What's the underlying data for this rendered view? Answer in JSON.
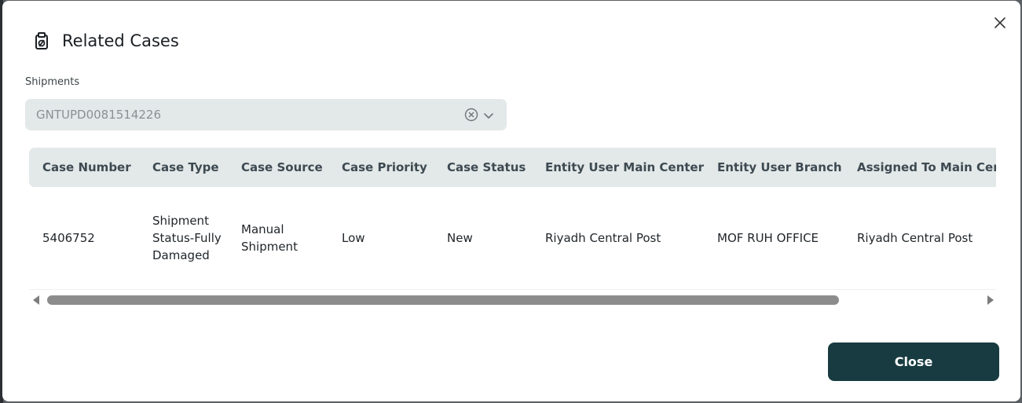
{
  "dialog": {
    "title": "Related Cases",
    "title_icon": "clipboard-edit-icon",
    "close_icon": "close-icon"
  },
  "shipments": {
    "label": "Shipments",
    "value": "GNTUPD0081514226",
    "clear_icon": "clear-circle-icon",
    "chevron_icon": "chevron-down-icon"
  },
  "table": {
    "columns": [
      "Case Number",
      "Case Type",
      "Case Source",
      "Case Priority",
      "Case Status",
      "Entity User Main Center",
      "Entity User Branch",
      "Assigned To Main Center"
    ],
    "rows": [
      {
        "case_number": "5406752",
        "case_type": "Shipment Status-Fully Damaged",
        "case_source": "Manual Shipment",
        "case_priority": "Low",
        "case_status": "New",
        "entity_user_main_center": "Riyadh Central Post",
        "entity_user_branch": "MOF RUH OFFICE",
        "assigned_to_main_center": "Riyadh Central Post"
      }
    ]
  },
  "footer": {
    "close_label": "Close"
  },
  "colors": {
    "primary_button": "#173b40",
    "header_bg": "#e3e8e8"
  }
}
